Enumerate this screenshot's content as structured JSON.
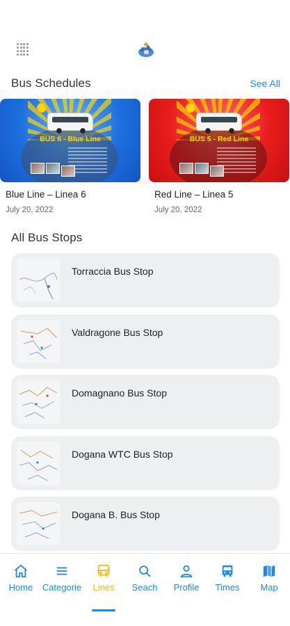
{
  "header": {
    "menu_icon": "grid-dots-icon",
    "logo_icon": "app-logo-icon"
  },
  "schedules": {
    "title": "Bus Schedules",
    "see_all": "See All",
    "cards": [
      {
        "banner_prefix": "BUS 6 - ",
        "banner_line": "Blue Line",
        "title": "Blue Line – Linea 6",
        "date": "July 20, 2022"
      },
      {
        "banner_prefix": "BUS 5 - ",
        "banner_line": "Red Line",
        "title": "Red Line – Linea 5",
        "date": "July 20, 2022"
      }
    ]
  },
  "stops": {
    "title": "All Bus Stops",
    "items": [
      {
        "name": "Torraccia Bus Stop"
      },
      {
        "name": "Valdragone Bus Stop"
      },
      {
        "name": "Domagnano Bus Stop"
      },
      {
        "name": "Dogana WTC Bus Stop"
      },
      {
        "name": "Dogana B. Bus Stop"
      }
    ]
  },
  "nav": {
    "items": [
      {
        "label": "Home",
        "icon": "home-icon"
      },
      {
        "label": "Categorie",
        "icon": "list-icon"
      },
      {
        "label": "Lines",
        "icon": "bus-icon"
      },
      {
        "label": "Seach",
        "icon": "search-icon"
      },
      {
        "label": "Profile",
        "icon": "person-icon"
      },
      {
        "label": "Times",
        "icon": "bus-front-icon"
      },
      {
        "label": "Map",
        "icon": "map-icon"
      }
    ],
    "active": "Lines",
    "colors": {
      "default": "#1e88e5",
      "active": "#f2b705"
    }
  }
}
